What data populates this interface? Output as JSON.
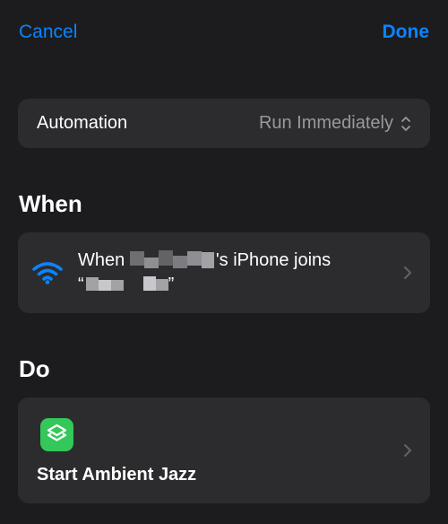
{
  "nav": {
    "cancel_label": "Cancel",
    "done_label": "Done"
  },
  "automation": {
    "label": "Automation",
    "value": "Run Immediately"
  },
  "sections": {
    "when_title": "When",
    "do_title": "Do"
  },
  "trigger": {
    "prefix": "When",
    "suffix": "'s iPhone joins",
    "open_quote": "“",
    "close_quote": "”",
    "icon": "wifi-icon"
  },
  "action": {
    "label": "Start Ambient Jazz",
    "icon": "shortcuts-icon"
  },
  "colors": {
    "background": "#1c1c1e",
    "card": "#2c2c2e",
    "accent": "#0a84ff",
    "secondary_text": "#98989f",
    "action_icon": "#34c759"
  }
}
